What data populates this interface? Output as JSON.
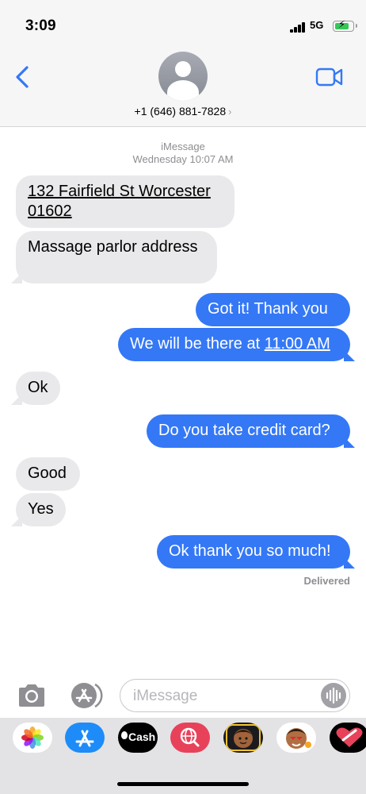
{
  "status": {
    "time": "3:09",
    "network": "5G"
  },
  "header": {
    "contact": "+1 (646) 881-7828",
    "chevron": "›"
  },
  "thread": {
    "service": "iMessage",
    "timestamp": "Wednesday 10:07 AM",
    "messages": [
      {
        "lines": [
          "132 Fairfield St Worcester",
          "01602"
        ]
      },
      {
        "text": "Massage parlor address"
      },
      {
        "text": "Got it!  Thank you"
      },
      {
        "prefix": "We will be there at ",
        "time": "11:00 AM"
      },
      {
        "text": "Ok"
      },
      {
        "text": "Do you take credit card?"
      },
      {
        "text": "Good"
      },
      {
        "text": "Yes"
      },
      {
        "text": "Ok thank you so much!"
      }
    ],
    "status": "Delivered"
  },
  "composer": {
    "placeholder": "iMessage"
  },
  "apps": {
    "cash_label": "Cash"
  },
  "icons": {
    "back": "chevron-left-icon",
    "video": "video-camera-icon",
    "camera": "camera-icon",
    "apps": "app-store-icon",
    "audio": "waveform-icon"
  },
  "colors": {
    "accent": "#3478f6",
    "received": "#e9e9eb",
    "battery": "#36c759"
  }
}
